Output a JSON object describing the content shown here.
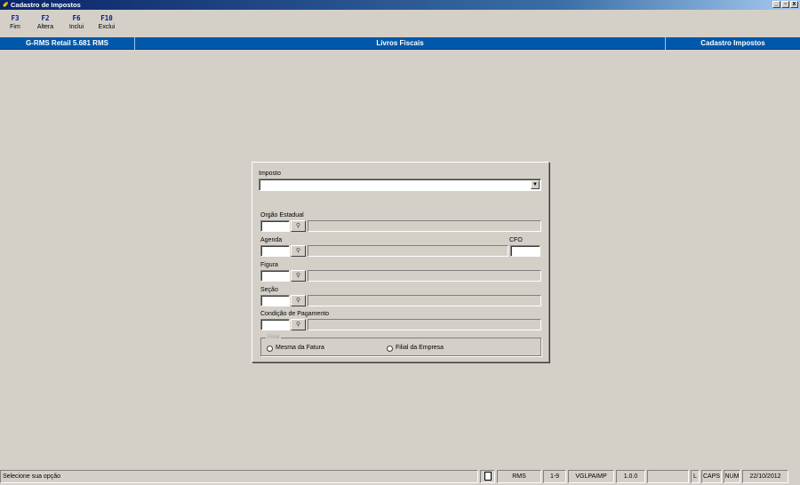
{
  "window": {
    "title": "Cadastro de Impostos",
    "app_icon": "feather-icon",
    "controls": [
      "_",
      "▫",
      "x"
    ]
  },
  "toolbar": [
    {
      "key": "F3",
      "label": "Fim"
    },
    {
      "key": "F2",
      "label": "Altera"
    },
    {
      "key": "F6",
      "label": "Inclui"
    },
    {
      "key": "F10",
      "label": "Exclui"
    }
  ],
  "header": {
    "system": "G-RMS Retail 5.681 RMS",
    "module": "Livros Fiscais",
    "screen": "Cadastro Impostos",
    "color": "#0058aa"
  },
  "form": {
    "imposto_label": "Imposto",
    "imposto_value": "",
    "orgao_label": "Orgão Estadual",
    "agenda_label": "Agenda",
    "cfo_label": "CFO",
    "figura_label": "Figura",
    "secao_label": "Seção",
    "condicao_label": "Condição de Pagamento",
    "search_icon": "binoculars-icon",
    "filial_group_label": "Filial",
    "radio_mesma": "Mesma da Fatura",
    "radio_filial": "Filial da Empresa"
  },
  "status": {
    "message": "Selecione sua opção",
    "doc_icon": "document-icon",
    "user": "RMS",
    "code": "1-9",
    "program": "VGLPAIMP",
    "version": "1.0.0",
    "empty": "",
    "l": "L",
    "caps": "CAPS",
    "num": "NUM",
    "date": "22/10/2012"
  }
}
